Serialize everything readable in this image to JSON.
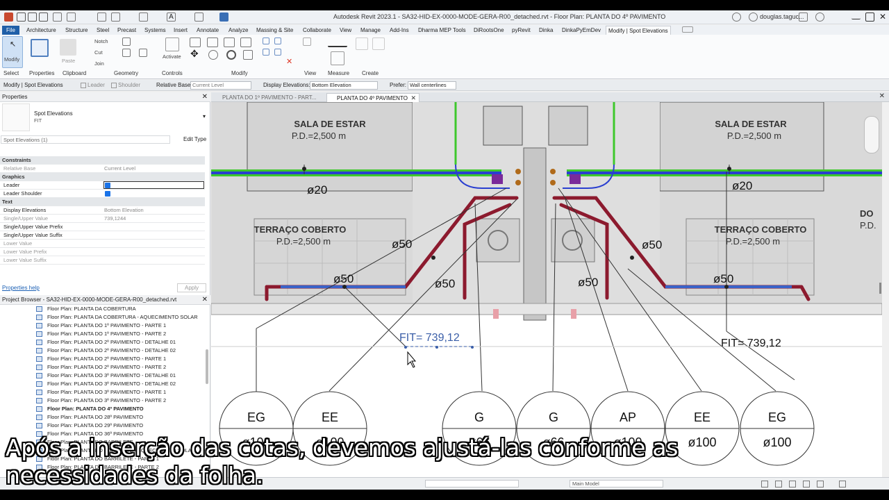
{
  "window": {
    "title": "Autodesk Revit 2023.1 - SA32-HID-EX-0000-MODE-GERA-R00_detached.rvt - Floor Plan: PLANTA DO 4º PAVIMENTO",
    "user": "douglas.taguc..."
  },
  "ribbon_tabs": [
    "File",
    "Architecture",
    "Structure",
    "Steel",
    "Precast",
    "Systems",
    "Insert",
    "Annotate",
    "Analyze",
    "Massing & Site",
    "Collaborate",
    "View",
    "Manage",
    "Add-Ins",
    "Dharma MEP Tools",
    "DiRootsOne",
    "pyRevit",
    "Dinka",
    "DinkaPyEmDev",
    "Modify | Spot Elevations"
  ],
  "ribbon": {
    "modify_label": "Modify",
    "paste_label": "Paste",
    "notch_label": "Notch",
    "cut_label": "Cut",
    "join_label": "Join",
    "activate_label": "Activate",
    "panels": [
      "Select",
      "Properties",
      "Clipboard",
      "Geometry",
      "Controls",
      "Modify",
      "View",
      "Measure",
      "Create"
    ]
  },
  "options_bar": {
    "context": "Modify | Spot Elevations",
    "leader": "Leader",
    "shoulder": "Shoulder",
    "relative_base_label": "Relative Base:",
    "relative_base_value": "Current Level",
    "display_elevations_label": "Display Elevations:",
    "display_elevations_value": "Bottom Elevation",
    "prefer_label": "Prefer:",
    "prefer_value": "Wall centerlines"
  },
  "properties": {
    "title": "Properties",
    "type_name": "Spot Elevations",
    "type_sub": "FIT",
    "instance": "Spot Elevations (1)",
    "edit_type": "Edit Type",
    "rows": [
      {
        "k": "Constraints",
        "v": "",
        "g": true
      },
      {
        "k": "Relative Base",
        "v": "Current Level",
        "dim": true
      },
      {
        "k": "Graphics",
        "v": "",
        "g": true
      },
      {
        "k": "Leader",
        "v": "",
        "chk": true
      },
      {
        "k": "Leader Shoulder",
        "v": "",
        "chk": true
      },
      {
        "k": "Text",
        "v": "",
        "g": true
      },
      {
        "k": "Display Elevations",
        "v": "Bottom Elevation"
      },
      {
        "k": "Single/Upper Value",
        "v": "739,1244",
        "dim": true
      },
      {
        "k": "Single/Upper Value Prefix",
        "v": ""
      },
      {
        "k": "Single/Upper Value Suffix",
        "v": ""
      },
      {
        "k": "Lower Value",
        "v": "",
        "dim": true
      },
      {
        "k": "Lower Value Prefix",
        "v": "",
        "dim": true
      },
      {
        "k": "Lower Value Suffix",
        "v": "",
        "dim": true
      }
    ],
    "help": "Properties help",
    "apply": "Apply"
  },
  "browser": {
    "title": "Project Browser - SA32-HID-EX-0000-MODE-GERA-R00_detached.rvt",
    "items": [
      "Floor Plan: PLANTA DA COBERTURA",
      "Floor Plan: PLANTA DA COBERTURA - AQUECIMENTO SOLAR",
      "Floor Plan: PLANTA DO 1º PAVIMENTO - PARTE 1",
      "Floor Plan: PLANTA DO 1º PAVIMENTO - PARTE 2",
      "Floor Plan: PLANTA DO 2º PAVIMENTO - DETALHE 01",
      "Floor Plan: PLANTA DO 2º PAVIMENTO - DETALHE 02",
      "Floor Plan: PLANTA DO 2º PAVIMENTO - PARTE 1",
      "Floor Plan: PLANTA DO 2º PAVIMENTO - PARTE 2",
      "Floor Plan: PLANTA DO 3º PAVIMENTO - DETALHE 01",
      "Floor Plan: PLANTA DO 3º PAVIMENTO - DETALHE 02",
      "Floor Plan: PLANTA DO 3º PAVIMENTO - PARTE 1",
      "Floor Plan: PLANTA DO 3º PAVIMENTO - PARTE 2",
      "Floor Plan: PLANTA DO 4º PAVIMENTO",
      "Floor Plan: PLANTA DO 28º PAVIMENTO",
      "Floor Plan: PLANTA DO 29º PAVIMENTO",
      "Floor Plan: PLANTA DO 36º PAVIMENTO",
      "Floor Plan: PLANTA DO BARRILETE",
      "Floor Plan: PLANTA DO BARRILETE - AQUECIMENTO SOLAR",
      "Floor Plan: PLANTA DO BARRILETE - PARTE 1",
      "Floor Plan: PLANTA DO BARRILETE - PARTE 2"
    ],
    "selected_index": 12
  },
  "view_tabs": [
    "PLANTA DO 1º PAVIMENTO - PART...",
    "PLANTA DO 4º PAVIMENTO"
  ],
  "drawing": {
    "rooms": [
      {
        "name": "SALA DE ESTAR",
        "pd": "P.D.=2,500   m"
      },
      {
        "name": "SALA DE ESTAR",
        "pd": "P.D.=2,500   m"
      },
      {
        "name": "TERRAÇO COBERTO",
        "pd": "P.D.=2,500   m"
      },
      {
        "name": "TERRAÇO COBERTO",
        "pd": "P.D.=2,500   m"
      },
      {
        "name": "DO",
        "pd": "P.D."
      }
    ],
    "diam_labels": [
      "ø20",
      "ø20",
      "ø50",
      "ø50",
      "ø50",
      "ø50",
      "ø50",
      "ø50"
    ],
    "spot_elevations": [
      "FIT= 739,12",
      "FIT= 739,12"
    ],
    "circles": [
      {
        "top": "EG",
        "bottom": "ø100"
      },
      {
        "top": "EE",
        "bottom": "ø100"
      },
      {
        "top": "G",
        "bottom": "ø66"
      },
      {
        "top": "G",
        "bottom": "ø66"
      },
      {
        "top": "AP",
        "bottom": "ø100"
      },
      {
        "top": "EE",
        "bottom": "ø100"
      },
      {
        "top": "EG",
        "bottom": "ø100"
      }
    ]
  },
  "status": {
    "model": "Main Model"
  },
  "captions": [
    "Após a inserção das cotas, devemos ajustá-las conforme as",
    "necessidades da folha."
  ]
}
